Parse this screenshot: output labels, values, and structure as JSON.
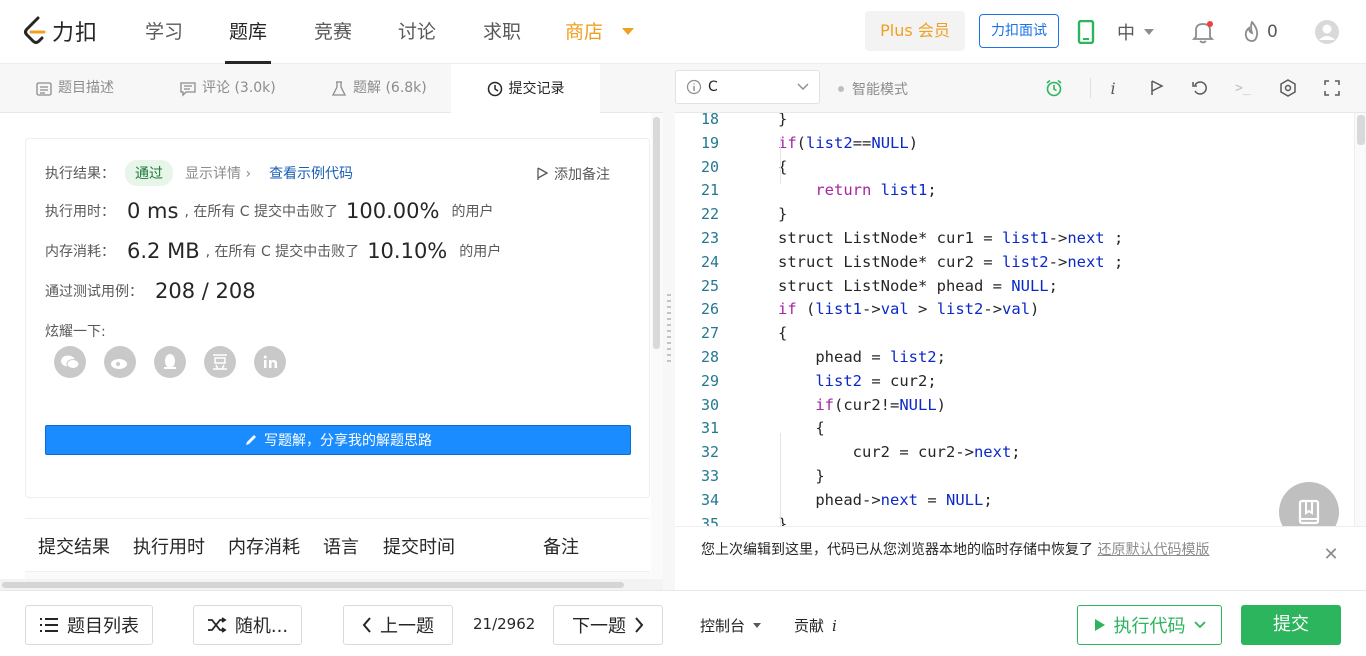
{
  "brand": {
    "name": "力扣"
  },
  "nav": {
    "items": [
      "学习",
      "题库",
      "竞赛",
      "讨论",
      "求职"
    ],
    "active": "题库",
    "shop": "商店"
  },
  "header": {
    "plus": "Plus 会员",
    "interview": "力扣面试",
    "lang": "中",
    "points": "0"
  },
  "tabs": [
    {
      "label": "题目描述",
      "icon": "description-icon"
    },
    {
      "label": "评论 (3.0k)",
      "icon": "comment-icon"
    },
    {
      "label": "题解 (6.8k)",
      "icon": "flask-icon"
    },
    {
      "label": "提交记录",
      "icon": "clock-icon",
      "active": true
    }
  ],
  "result": {
    "label_result": "执行结果：",
    "status": "通过",
    "show_details": "显示详情 ›",
    "view_example": "查看示例代码",
    "add_note": "添加备注",
    "label_time": "执行用时：",
    "time_value": "0 ms",
    "time_beat_prefix": ", 在所有 C 提交中击败了",
    "time_percent": "100.00%",
    "users_suffix": "的用户",
    "label_memory": "内存消耗：",
    "memory_value": "6.2 MB",
    "memory_beat_prefix": ", 在所有 C 提交中击败了",
    "memory_percent": "10.10%",
    "label_tests": "通过测试用例：",
    "tests_value": "208 / 208",
    "share_label": "炫耀一下:",
    "write_solution": "写题解，分享我的解题思路"
  },
  "social_icons": [
    "wechat-icon",
    "weibo-icon",
    "qq-icon",
    "douban-icon",
    "linkedin-icon"
  ],
  "submissions_table": {
    "columns": [
      "提交结果",
      "执行用时",
      "内存消耗",
      "语言",
      "提交时间",
      "备注"
    ]
  },
  "editor": {
    "language": "C",
    "smart_mode": "智能模式",
    "code_lines": [
      {
        "n": "18",
        "t": "}"
      },
      {
        "n": "19",
        "t": "if(list2==NULL)"
      },
      {
        "n": "20",
        "t": "{"
      },
      {
        "n": "21",
        "t": "    return list1;"
      },
      {
        "n": "22",
        "t": "}"
      },
      {
        "n": "23",
        "t": "struct ListNode* cur1 = list1->next ;"
      },
      {
        "n": "24",
        "t": "struct ListNode* cur2 = list2->next ;"
      },
      {
        "n": "25",
        "t": "struct ListNode* phead = NULL;"
      },
      {
        "n": "26",
        "t": "if (list1->val > list2->val)"
      },
      {
        "n": "27",
        "t": "{"
      },
      {
        "n": "28",
        "t": "    phead = list2;"
      },
      {
        "n": "29",
        "t": "    list2 = cur2;"
      },
      {
        "n": "30",
        "t": "    if(cur2!=NULL)"
      },
      {
        "n": "31",
        "t": "    {"
      },
      {
        "n": "32",
        "t": "        cur2 = cur2->next;"
      },
      {
        "n": "33",
        "t": "    }"
      },
      {
        "n": "34",
        "t": "    phead->next = NULL;"
      },
      {
        "n": "35",
        "t": "}"
      }
    ]
  },
  "restore": {
    "message": "您上次编辑到这里，代码已从您浏览器本地的临时存储中恢复了",
    "link": "还原默认代码模版"
  },
  "bottom": {
    "problem_list": "题目列表",
    "random": "随机...",
    "prev": "上一题",
    "page": "21/2962",
    "next": "下一题",
    "console": "控制台",
    "contribute": "贡献",
    "run": "执行代码",
    "submit": "提交"
  },
  "colors": {
    "accent_blue": "#1a8cff",
    "success_green": "#2db55d",
    "shop_orange": "#f0a020"
  }
}
